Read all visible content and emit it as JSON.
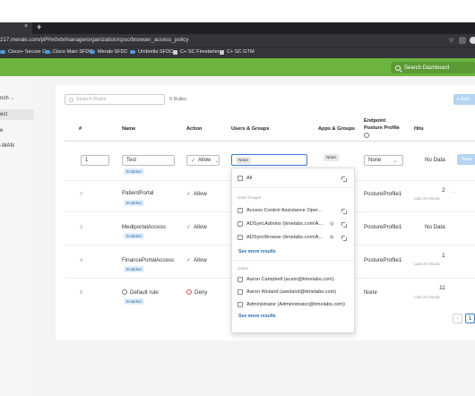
{
  "browser": {
    "tab_close": "×",
    "new_tab": "+",
    "url": "217.meraki.com/pPHx0xb/manage/organization/cpsc/browser_access_policy",
    "bookmarks": [
      "Cisco+ Secure Co...",
      "Cisco Main SFDC",
      "Meraki SFDC",
      "Umbrella SFDC",
      "C+ SC Firestarter",
      "C+ SC GTM"
    ]
  },
  "header": {
    "search_label": "Search Dashboard"
  },
  "sidebar": {
    "items": [
      "nch",
      "ect",
      "e",
      "-WAN"
    ]
  },
  "toolbar": {
    "search_placeholder": "Search Rules",
    "rules_count": "5 Rules",
    "add_label": "+ Add"
  },
  "columns": {
    "num": "#",
    "name": "Name",
    "action": "Action",
    "users": "Users & Groups",
    "apps": "Apps & Groups",
    "posture_line1": "Endpoint",
    "posture_line2": "Posture Profile",
    "hits": "Hits"
  },
  "edit_row": {
    "index": "1",
    "name": "Test",
    "status": "Enabled",
    "action": "Allow",
    "users_chip": "None",
    "apps_chip": "None",
    "posture": "None",
    "hits": "No Data",
    "save_label": "Save"
  },
  "rows": [
    {
      "num": "2",
      "name": "PatientPortal",
      "status": "Enabled",
      "action": "Allow",
      "posture": "PostureProfile1",
      "hits": "2",
      "hits_sub": "Last 24 Hours"
    },
    {
      "num": "3",
      "name": "MediportalAccess",
      "status": "Enabled",
      "action": "Allow",
      "posture": "PostureProfile1",
      "hits": "No Data",
      "hits_sub": ""
    },
    {
      "num": "4",
      "name": "FinancePortalAccess",
      "status": "Enabled",
      "action": "Allow",
      "posture": "PostureProfile1",
      "hits": "1",
      "hits_sub": "Last 24 Hours"
    },
    {
      "num": "5",
      "name": "Default rule",
      "status": "Enabled",
      "action": "Deny",
      "posture": "None",
      "hits": "11",
      "hits_sub": "Last 24 Hours"
    }
  ],
  "dropdown": {
    "all_label": "All",
    "user_groups_heading": "User Groups",
    "groups": [
      {
        "label": "Access Control Assistance Oper...",
        "count": ""
      },
      {
        "label": "ADSyncAdmins (timelabs.com\\A...",
        "count": "1"
      },
      {
        "label": "ADSyncBrowse (timelabs.com\\A...",
        "count": "0"
      }
    ],
    "see_more_groups": "See more results",
    "users_heading": "Users",
    "users": [
      "Aaron Campbell (acam@timelabs.com)",
      "Aaron Woland (awoland@timelabs.com)",
      "Administrator (Administrator@timelabs.com)"
    ],
    "see_more_users": "See more results"
  },
  "pagination": {
    "prev": "‹",
    "current": "1"
  }
}
